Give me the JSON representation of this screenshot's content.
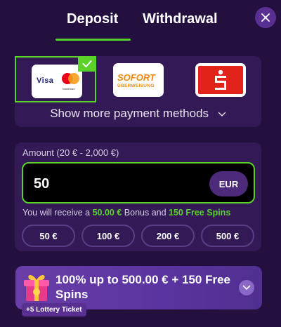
{
  "tabs": {
    "deposit": "Deposit",
    "withdrawal": "Withdrawal"
  },
  "methods": {
    "items": [
      {
        "name": "Visa",
        "second": "mastercard",
        "selected": true
      },
      {
        "name": "SOFORT",
        "sub": "ÜBERWEISUNG",
        "selected": false
      },
      {
        "name": "Sparkasse",
        "selected": false
      }
    ],
    "show_more": "Show more payment methods"
  },
  "amount": {
    "label": "Amount (20 € - 2,000 €)",
    "value": "50",
    "currency": "EUR"
  },
  "bonus": {
    "prefix": "You will receive a ",
    "amount": "50.00 €",
    "middle": " Bonus and ",
    "spins": "150 Free Spins"
  },
  "presets": [
    "50 €",
    "100 €",
    "200 €",
    "500 €"
  ],
  "promo": {
    "title": "100% up to 500.00 € + 150 Free Spins",
    "badge": "+5 Lottery Ticket"
  },
  "colors": {
    "accent": "#5bd12a",
    "background": "#24103f",
    "panel": "#331a57"
  }
}
